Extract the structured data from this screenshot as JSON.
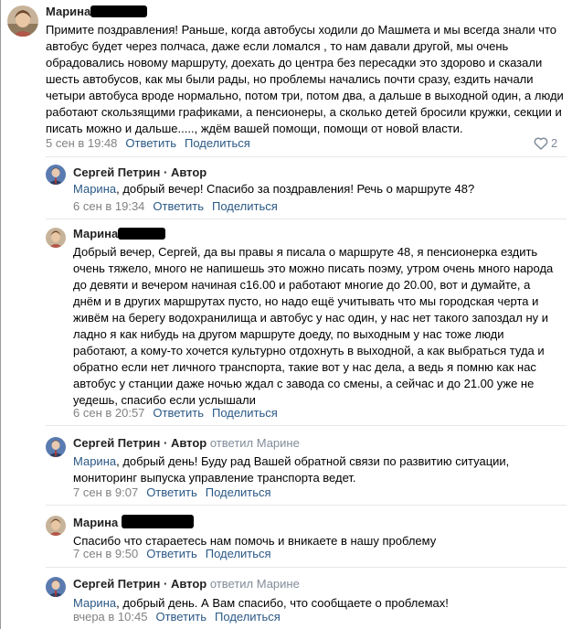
{
  "comments": [
    {
      "author": "Марина",
      "text": "Примите поздравления! Раньше, когда автобусы ходили до Машмета и мы всегда знали что автобус будет через полчаса, даже если ломался , то нам давали другой, мы очень обрадовались новому маршруту, доехать до центра без пересадки это здорово и сказали шесть автобусов, как мы были рады, но проблемы начались почти сразу, ездить начали четыри автобуса вроде нормально, потом три, потом два, а дальше в выходной один, а люди работают скользящими графиками, а пенсионеры, а сколько детей бросили кружки, секции и писать можно и дальше....., ждём вашей помощи, помощи от новой власти.",
      "date": "5 сен в 19:48",
      "reply": "Ответить",
      "share": "Поделиться",
      "likes": "2"
    },
    {
      "author": "Сергей Петрин",
      "badge": "· Автор",
      "mention": "Марина",
      "text": ", добрый вечер! Спасибо за поздравления! Речь о маршруте 48?",
      "date": "6 сен в 19:34",
      "reply": "Ответить",
      "share": "Поделиться"
    },
    {
      "author": "Марина",
      "text": "Добрый вечер, Сергей, да вы правы я писала о маршруте 48, я пенсионерка ездить очень тяжело, много не напишешь это можно писать поэму, утром очень много народа до девяти и вечером начиная с16.00 и работают многие до 20.00, вот и думайте, а днём и в других маршрутах пусто, но надо ещё учитывать что мы городская черта и живём на берегу водохранилища и автобус у нас один, у нас нет такого запоздал ну и ладно я как нибудь на другом маршруте доеду, по выходным у нас тоже люди работают, а кому-то хочется культурно отдохнуть в выходной, а как выбраться туда и обратно если нет личного транспорта, такие вот у нас дела, а ведь я помню как нас автобус у станции даже ночью ждал с завода со смены, а сейчас и до 21.00 уже не уедешь, спасибо если услышали",
      "date": "6 сен в 20:57",
      "reply": "Ответить",
      "share": "Поделиться"
    },
    {
      "author": "Сергей Петрин",
      "badge": "· Автор",
      "replied_to": "ответил Марине",
      "mention": "Марина",
      "text": ", добрый день! Буду рад Вашей обратной связи по развитию ситуации, мониторинг выпуска управление транспорта ведет.",
      "date": "7 сен в 9:07",
      "reply": "Ответить",
      "share": "Поделиться"
    },
    {
      "author": "Марина",
      "text": "Спасибо что стараетесь нам помочь и вникаете в нашу проблему",
      "date": "7 сен в 9:50",
      "reply": "Ответить",
      "share": "Поделиться"
    },
    {
      "author": "Сергей Петрин",
      "badge": "· Автор",
      "replied_to": "ответил Марине",
      "mention": "Марина",
      "text": ", добрый день. А Вам спасибо, что сообщаете о проблемах!",
      "date": "вчера в 10:45",
      "reply": "Ответить",
      "share": "Поделиться"
    }
  ],
  "colors": {
    "link": "#2a5885",
    "meta": "#828282",
    "separator": "#e7e8ec"
  },
  "icons": [
    "heart-icon"
  ]
}
